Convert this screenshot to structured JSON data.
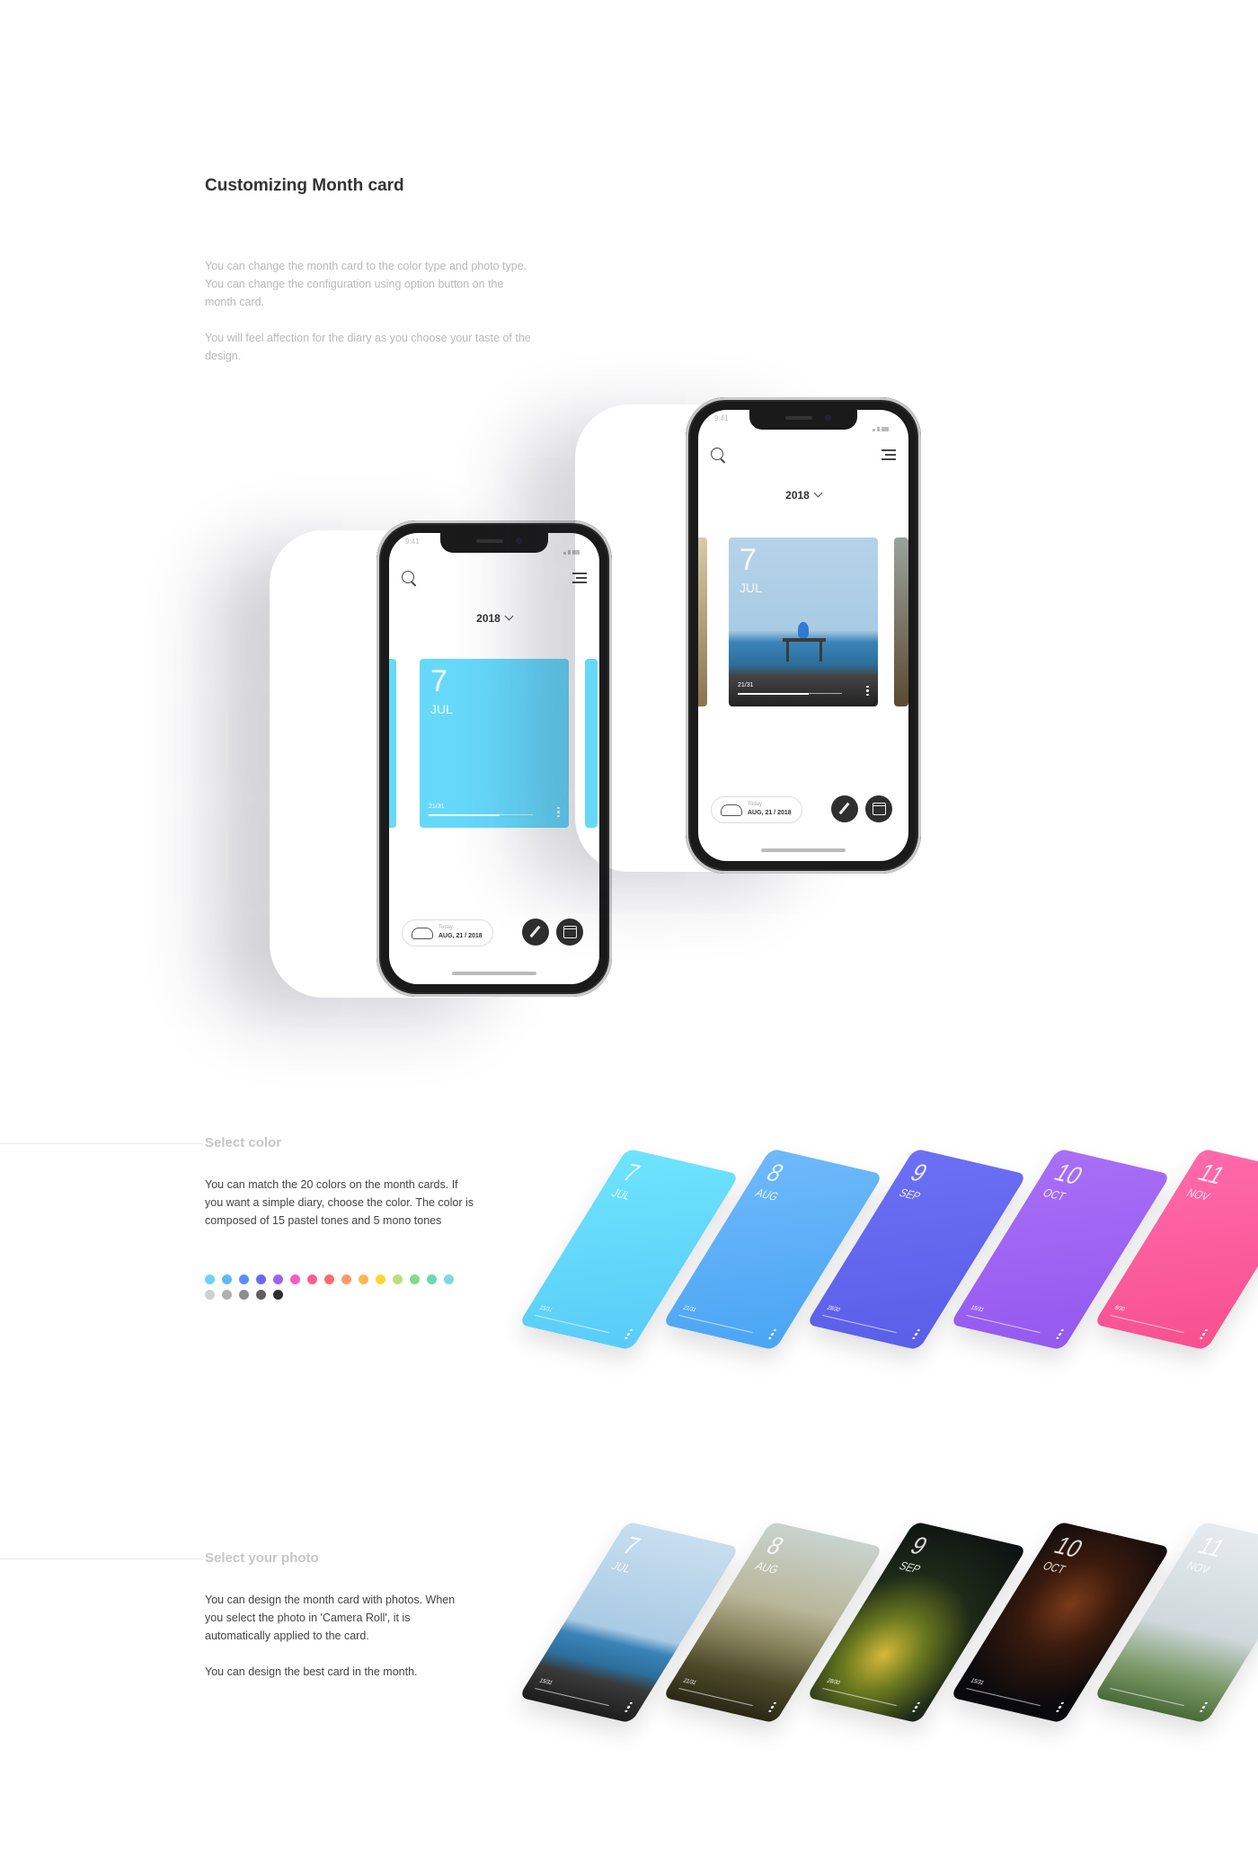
{
  "intro": {
    "title": "Customizing Month card",
    "paragraph1": "You can change the month card to the color type and photo type. You can change the configuration using option button on the month card.",
    "paragraph2": "You will feel affection for the diary as you choose your taste of the design."
  },
  "phone": {
    "status_time": "9:41",
    "year": "2018",
    "card_day": "7",
    "card_month": "JUL",
    "card_progress": "21/31",
    "card_progress_value": 0.68,
    "today_label": "Today",
    "today_date": "AUG, 21 / 2018"
  },
  "colors": {
    "accent_card": "#66d9fb",
    "ink": "#333333"
  },
  "select_color": {
    "title": "Select color",
    "description": "You can match the 20 colors on the month cards. If you want a simple diary, choose the color. The color is composed of 15 pastel tones and 5 mono tones",
    "pastel_tones": [
      "#66d6f8",
      "#63b8f7",
      "#5b8df5",
      "#6a6af0",
      "#9a63ef",
      "#f35ec6",
      "#f95f92",
      "#ff6b6b",
      "#ff9966",
      "#ffb84d",
      "#ffd633",
      "#b8e07a",
      "#7ddb8f",
      "#66d9b8",
      "#7adbe0"
    ],
    "mono_tones": [
      "#d0d0d0",
      "#b0b0b0",
      "#8e8e8e",
      "#5f5f5f",
      "#2e2e2e"
    ],
    "cards": [
      {
        "day": "7",
        "month": "JUL",
        "progress": "15/31",
        "colors": [
          "#6fe4fd",
          "#58ccf7"
        ]
      },
      {
        "day": "8",
        "month": "AUG",
        "progress": "21/31",
        "colors": [
          "#6fb9fb",
          "#4aa5f4"
        ]
      },
      {
        "day": "9",
        "month": "SEP",
        "progress": "28/30",
        "colors": [
          "#6c70f5",
          "#5a5ee8"
        ]
      },
      {
        "day": "10",
        "month": "OCT",
        "progress": "15/31",
        "colors": [
          "#a96ff7",
          "#9459ee"
        ]
      },
      {
        "day": "11",
        "month": "NOV",
        "progress": "8/30",
        "colors": [
          "#ff6aaa",
          "#f7508f"
        ]
      }
    ]
  },
  "select_photo": {
    "title": "Select your photo",
    "description1": "You can design the month card with photos. When you select the photo in 'Camera Roll', it is automatically applied to the card.",
    "description2": "You can design the best card in the month.",
    "cards": [
      {
        "day": "7",
        "month": "JUL",
        "progress": "15/31"
      },
      {
        "day": "8",
        "month": "AUG",
        "progress": "21/31"
      },
      {
        "day": "9",
        "month": "SEP",
        "progress": "28/30"
      },
      {
        "day": "10",
        "month": "OCT",
        "progress": "15/31"
      },
      {
        "day": "11",
        "month": "NOV",
        "progress": ""
      }
    ]
  }
}
